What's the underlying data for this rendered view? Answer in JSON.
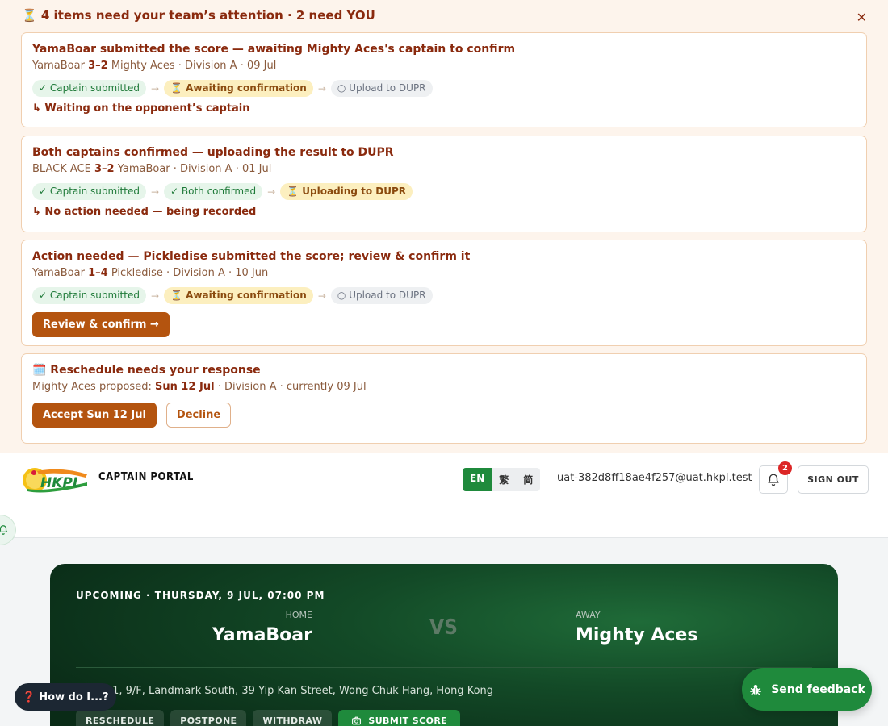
{
  "attention": {
    "header": "⏳ 4 items need your team’s attention · 2 need YOU",
    "close": "✕",
    "cards": [
      {
        "title": "YamaBoar submitted the score — awaiting Mighty Aces's captain to confirm",
        "home": "YamaBoar",
        "score": "3–2",
        "away": "Mighty Aces",
        "rest": "· Division A · 09 Jul",
        "steps": [
          {
            "label": "✓ Captain submitted",
            "state": "done"
          },
          {
            "label": "⏳ Awaiting confirmation",
            "state": "active"
          },
          {
            "label": "○ Upload to DUPR",
            "state": "todo"
          }
        ],
        "note": "↳ Waiting on the opponent’s captain"
      },
      {
        "title": "Both captains confirmed — uploading the result to DUPR",
        "home": "BLACK ACE",
        "score": "3–2",
        "away": "YamaBoar",
        "rest": "· Division A · 01 Jul",
        "steps": [
          {
            "label": "✓ Captain submitted",
            "state": "done"
          },
          {
            "label": "✓ Both confirmed",
            "state": "done"
          },
          {
            "label": "⏳ Uploading to DUPR",
            "state": "active"
          }
        ],
        "note": "↳ No action needed — being recorded"
      },
      {
        "title": "Action needed — Pickledise submitted the score; review & confirm it",
        "home": "YamaBoar",
        "score": "1–4",
        "away": "Pickledise",
        "rest": "· Division A · 10 Jun",
        "steps": [
          {
            "label": "✓ Captain submitted",
            "state": "done"
          },
          {
            "label": "⏳ Awaiting confirmation",
            "state": "active"
          },
          {
            "label": "○ Upload to DUPR",
            "state": "todo"
          }
        ],
        "button": "Review & confirm →"
      },
      {
        "title": "🗓️ Reschedule needs your response",
        "meta_prefix": "Mighty Aces proposed:",
        "meta_bold": "Sun 12 Jul",
        "meta_suffix": "· Division A · currently 09 Jul",
        "accept": "Accept Sun 12 Jul",
        "decline": "Decline"
      }
    ],
    "arrow": "→"
  },
  "header": {
    "logo_text": "HKPL",
    "portal": "CAPTAIN PORTAL",
    "langs": [
      "EN",
      "繁",
      "简"
    ],
    "active_lang": "EN",
    "email": "uat-382d8ff18ae4f257@uat.hkpl.test",
    "notifications": "2",
    "signout": "SIGN OUT"
  },
  "match": {
    "when": "UPCOMING · THURSDAY, 9 JUL, 07:00 PM",
    "home_label": "HOME",
    "home": "YamaBoar",
    "vs": "VS",
    "away_label": "AWAY",
    "away": "Mighty Aces",
    "location": "Shop 01, 9/F, Landmark South, 39 Yip Kan Street, Wong Chuk Hang, Hong Kong",
    "actions": [
      "RESCHEDULE",
      "POSTPONE",
      "WITHDRAW"
    ],
    "submit": "SUBMIT SCORE"
  },
  "help": "❓ How do I...?",
  "feedback": "Send feedback",
  "colors": {
    "accent": "#1f8a3c",
    "warn": "#b4540f",
    "heading": "#8a2a0e"
  }
}
